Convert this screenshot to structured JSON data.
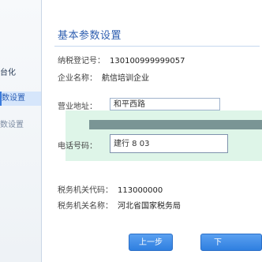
{
  "sidebar": {
    "items": [
      {
        "label": "台化"
      },
      {
        "label": "数设置"
      },
      {
        "label": "数设置"
      }
    ]
  },
  "main": {
    "title": "基本参数设置",
    "fields": {
      "tax_id_label": "纳税登记号：",
      "tax_id_value": "130100999999057",
      "company_label": "企业名称：",
      "company_value": "航信培训企业",
      "address_label": "营业地址：",
      "address_value": "和平西路",
      "phone_label": "电话号码：",
      "phone_value": "建行 8 03",
      "tax_office_code_label": "税务机关代码：",
      "tax_office_code_value": "113000000",
      "tax_office_name_label": "税务机关名称：",
      "tax_office_name_value": "河北省国家税务局"
    },
    "buttons": {
      "prev": "上一步",
      "next": "下"
    }
  }
}
